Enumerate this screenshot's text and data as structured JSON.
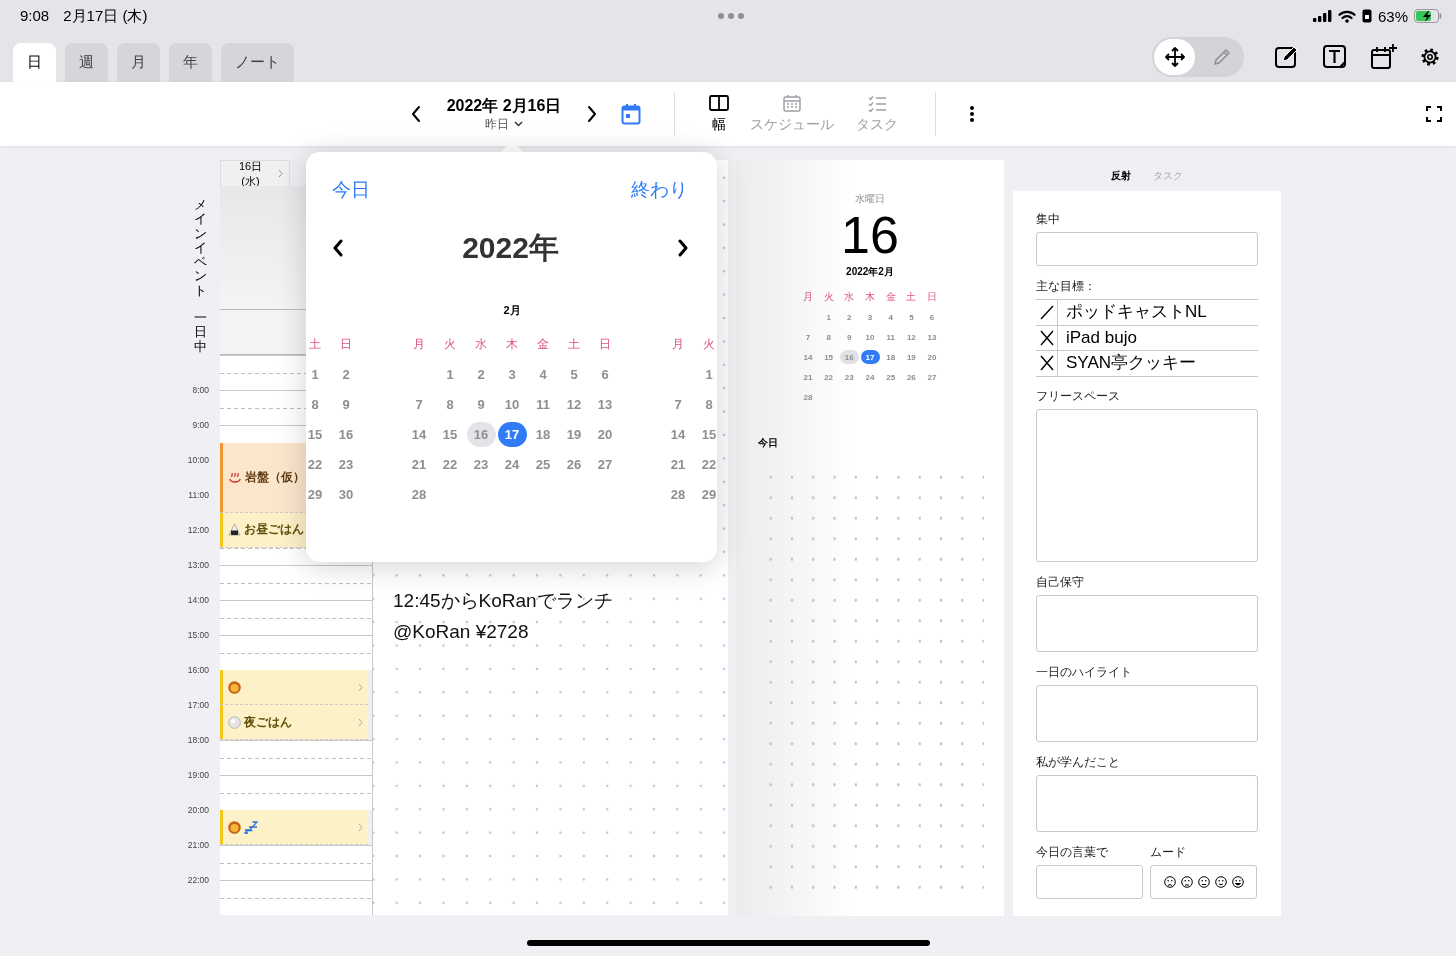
{
  "status_bar": {
    "time": "9:08",
    "date": "2月17日 (木)",
    "battery": "63%"
  },
  "tabs": [
    {
      "label": "日",
      "selected": true
    },
    {
      "label": "週",
      "selected": false
    },
    {
      "label": "月",
      "selected": false
    },
    {
      "label": "年",
      "selected": false
    },
    {
      "label": "ノート",
      "selected": false
    }
  ],
  "tool_modes": [
    {
      "kind": "move",
      "selected": true
    },
    {
      "kind": "pencil",
      "selected": false
    }
  ],
  "toolbar": {
    "date": "2022年 2月16日",
    "relative": "昨日",
    "views": [
      {
        "label": "幅",
        "selected": true
      },
      {
        "label": "スケジュール",
        "selected": false
      },
      {
        "label": "タスク",
        "selected": false
      }
    ]
  },
  "timeline": {
    "header": "16日 (水)",
    "sections": [
      "メインイベント",
      "一日中"
    ],
    "hours": [
      "8:00",
      "9:00",
      "10:00",
      "11:00",
      "12:00",
      "13:00",
      "14:00",
      "15:00",
      "16:00",
      "17:00",
      "18:00",
      "19:00",
      "20:00",
      "21:00",
      "22:00"
    ],
    "events": [
      {
        "title": "岩盤（仮）",
        "color": "#f0962c",
        "chevron": false
      },
      {
        "title": "お昼ごはん",
        "color": "#f5c518",
        "chevron": false
      },
      {
        "color": "#f5c518",
        "chevron": true
      },
      {
        "title": "夜ごはん",
        "color": "#f5c518",
        "chevron": true
      },
      {
        "color": "#f5c518",
        "chevron": true
      }
    ]
  },
  "notes": {
    "lines": [
      "12:45からKoRanでランチ",
      "@KoRan ¥2728"
    ]
  },
  "day_page": {
    "weekday": "水曜日",
    "day": "16",
    "month": "2022年2月",
    "today_label": "今日",
    "calendar": {
      "weekdays": [
        "月",
        "火",
        "水",
        "木",
        "金",
        "土",
        "日"
      ],
      "weeks": [
        [
          {
            "day": "1",
            "selected": false,
            "today": false
          },
          {
            "day": "2",
            "selected": false,
            "today": false
          },
          {
            "day": "3",
            "selected": false,
            "today": false
          },
          {
            "day": "4",
            "selected": false,
            "today": false
          },
          {
            "day": "5",
            "selected": false,
            "today": false
          },
          {
            "day": "6",
            "selected": false,
            "today": false
          }
        ],
        [
          {
            "day": "7",
            "selected": false,
            "today": false
          },
          {
            "day": "8",
            "selected": false,
            "today": false
          },
          {
            "day": "9",
            "selected": false,
            "today": false
          },
          {
            "day": "10",
            "selected": false,
            "today": false
          },
          {
            "day": "11",
            "selected": false,
            "today": false
          },
          {
            "day": "12",
            "selected": false,
            "today": false
          },
          {
            "day": "13",
            "selected": false,
            "today": false
          }
        ],
        [
          {
            "day": "14",
            "selected": false,
            "today": false
          },
          {
            "day": "15",
            "selected": false,
            "today": false
          },
          {
            "day": "16",
            "selected": true,
            "today": false
          },
          {
            "day": "17",
            "selected": false,
            "today": true
          },
          {
            "day": "18",
            "selected": false,
            "today": false
          },
          {
            "day": "19",
            "selected": false,
            "today": false
          },
          {
            "day": "20",
            "selected": false,
            "today": false
          }
        ],
        [
          {
            "day": "21",
            "selected": false,
            "today": false
          },
          {
            "day": "22",
            "selected": false,
            "today": false
          },
          {
            "day": "23",
            "selected": false,
            "today": false
          },
          {
            "day": "24",
            "selected": false,
            "today": false
          },
          {
            "day": "25",
            "selected": false,
            "today": false
          },
          {
            "day": "26",
            "selected": false,
            "today": false
          },
          {
            "day": "27",
            "selected": false,
            "today": false
          }
        ],
        [
          {
            "day": "28",
            "selected": false,
            "today": false
          }
        ]
      ]
    }
  },
  "reflection": {
    "tabs": [
      {
        "label": "反射",
        "selected": true
      },
      {
        "label": "タスク",
        "selected": false
      }
    ],
    "sections": [
      {
        "label": "集中",
        "kind": "field"
      },
      {
        "label": "主な目標：",
        "kind": "goals",
        "goals": [
          {
            "text": "ポッドキャストNL",
            "done": false
          },
          {
            "text": "iPad bujo",
            "done": true
          },
          {
            "text": "SYAN亭クッキー",
            "done": true
          }
        ]
      },
      {
        "label": "フリースペース",
        "kind": "notes"
      },
      {
        "label": "自己保守",
        "kind": "box"
      },
      {
        "label": "一日のハイライト",
        "kind": "box"
      },
      {
        "label": "私が学んだこと",
        "kind": "box"
      },
      {
        "kind": "pair",
        "items": [
          {
            "label": "今日の言葉で",
            "kind": "field"
          },
          {
            "label": "ムード",
            "kind": "mood"
          }
        ]
      }
    ]
  },
  "popup": {
    "today": "今日",
    "done": "終わり",
    "year": "2022年",
    "months": [
      {
        "weekdays": [
          "土",
          "日"
        ],
        "weeks": [
          [
            {
              "day": "1",
              "selected": false,
              "today": false
            },
            {
              "day": "2",
              "selected": false,
              "today": false
            }
          ],
          [
            {
              "day": "8",
              "selected": false,
              "today": false
            },
            {
              "day": "9",
              "selected": false,
              "today": false
            }
          ],
          [
            {
              "day": "15",
              "selected": false,
              "today": false
            },
            {
              "day": "16",
              "selected": false,
              "today": false
            }
          ],
          [
            {
              "day": "22",
              "selected": false,
              "today": false
            },
            {
              "day": "23",
              "selected": false,
              "today": false
            }
          ],
          [
            {
              "day": "29",
              "selected": false,
              "today": false
            },
            {
              "day": "30",
              "selected": false,
              "today": false
            }
          ]
        ]
      },
      {
        "label": "2月",
        "weekdays": [
          "月",
          "火",
          "水",
          "木",
          "金",
          "土",
          "日"
        ],
        "weeks": [
          [
            {
              "day": "1",
              "selected": false,
              "today": false
            },
            {
              "day": "2",
              "selected": false,
              "today": false
            },
            {
              "day": "3",
              "selected": false,
              "today": false
            },
            {
              "day": "4",
              "selected": false,
              "today": false
            },
            {
              "day": "5",
              "selected": false,
              "today": false
            },
            {
              "day": "6",
              "selected": false,
              "today": false
            }
          ],
          [
            {
              "day": "7",
              "selected": false,
              "today": false
            },
            {
              "day": "8",
              "selected": false,
              "today": false
            },
            {
              "day": "9",
              "selected": false,
              "today": false
            },
            {
              "day": "10",
              "selected": false,
              "today": false
            },
            {
              "day": "11",
              "selected": false,
              "today": false
            },
            {
              "day": "12",
              "selected": false,
              "today": false
            },
            {
              "day": "13",
              "selected": false,
              "today": false
            }
          ],
          [
            {
              "day": "14",
              "selected": false,
              "today": false
            },
            {
              "day": "15",
              "selected": false,
              "today": false
            },
            {
              "day": "16",
              "selected": true,
              "today": false
            },
            {
              "day": "17",
              "selected": false,
              "today": true
            },
            {
              "day": "18",
              "selected": false,
              "today": false
            },
            {
              "day": "19",
              "selected": false,
              "today": false
            },
            {
              "day": "20",
              "selected": false,
              "today": false
            }
          ],
          [
            {
              "day": "21",
              "selected": false,
              "today": false
            },
            {
              "day": "22",
              "selected": false,
              "today": false
            },
            {
              "day": "23",
              "selected": false,
              "today": false
            },
            {
              "day": "24",
              "selected": false,
              "today": false
            },
            {
              "day": "25",
              "selected": false,
              "today": false
            },
            {
              "day": "26",
              "selected": false,
              "today": false
            },
            {
              "day": "27",
              "selected": false,
              "today": false
            }
          ],
          [
            {
              "day": "28",
              "selected": false,
              "today": false
            }
          ]
        ]
      },
      {
        "weekdays": [
          "月",
          "火"
        ],
        "weeks": [
          [
            {
              "day": "1",
              "selected": false,
              "today": false
            }
          ],
          [
            {
              "day": "7",
              "selected": false,
              "today": false
            },
            {
              "day": "8",
              "selected": false,
              "today": false
            }
          ],
          [
            {
              "day": "14",
              "selected": false,
              "today": false
            },
            {
              "day": "15",
              "selected": false,
              "today": false
            }
          ],
          [
            {
              "day": "21",
              "selected": false,
              "today": false
            },
            {
              "day": "22",
              "selected": false,
              "today": false
            }
          ],
          [
            {
              "day": "28",
              "selected": false,
              "today": false
            },
            {
              "day": "29",
              "selected": false,
              "today": false
            }
          ]
        ]
      }
    ]
  }
}
